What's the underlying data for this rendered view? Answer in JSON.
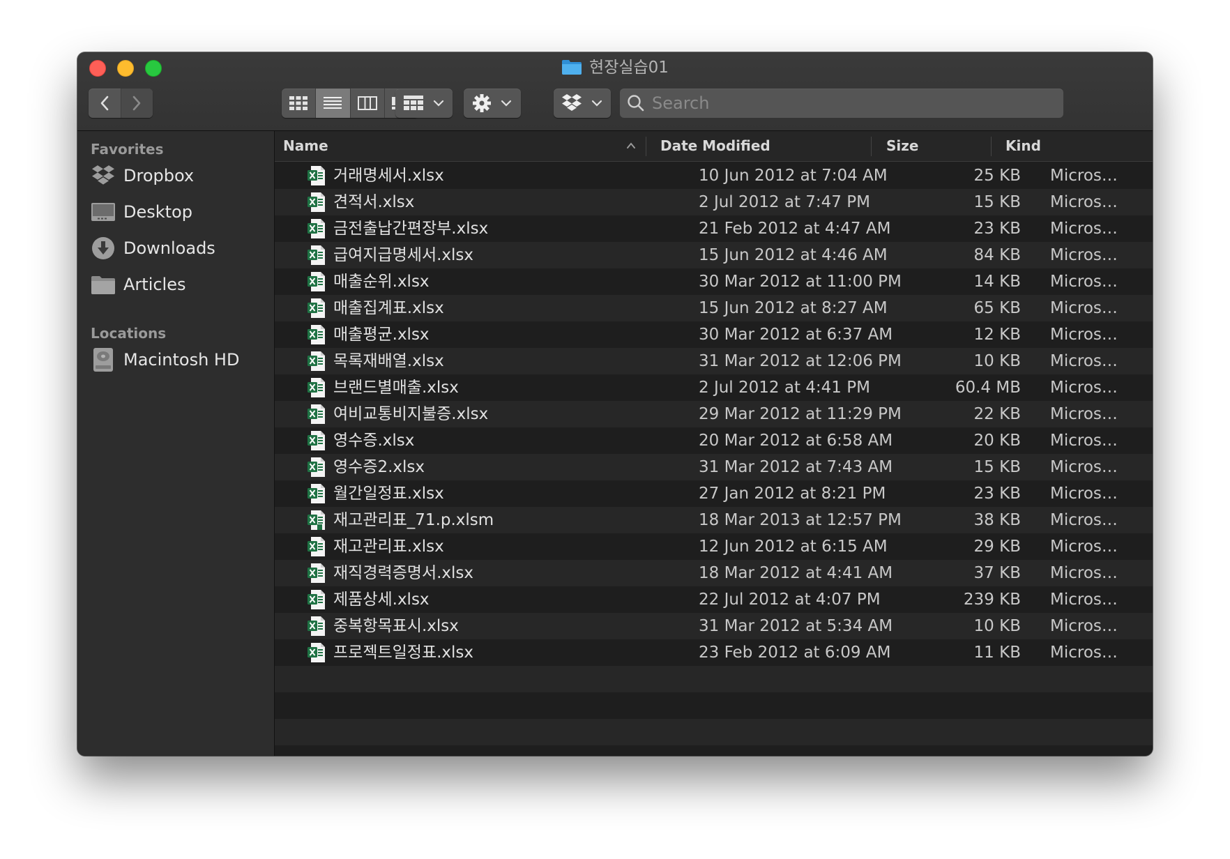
{
  "window": {
    "title": "현장실습01"
  },
  "toolbar": {
    "back_label": "Back",
    "forward_label": "Forward",
    "search_placeholder": "Search"
  },
  "sidebar": {
    "favorites_heading": "Favorites",
    "favorites": [
      {
        "label": "Dropbox",
        "icon": "dropbox-icon"
      },
      {
        "label": "Desktop",
        "icon": "desktop-icon"
      },
      {
        "label": "Downloads",
        "icon": "downloads-icon"
      },
      {
        "label": "Articles",
        "icon": "folder-icon"
      }
    ],
    "locations_heading": "Locations",
    "locations": [
      {
        "label": "Macintosh HD",
        "icon": "hard-drive-icon"
      }
    ]
  },
  "columns": {
    "name": "Name",
    "date": "Date Modified",
    "size": "Size",
    "kind": "Kind"
  },
  "files": [
    {
      "name": "거래명세서.xlsx",
      "date": "10 Jun 2012 at 7:04 AM",
      "size": "25 KB",
      "kind": "Micros…"
    },
    {
      "name": "견적서.xlsx",
      "date": "2 Jul 2012 at 7:47 PM",
      "size": "15 KB",
      "kind": "Micros…"
    },
    {
      "name": "금전출납간편장부.xlsx",
      "date": "21 Feb 2012 at 4:47 AM",
      "size": "23 KB",
      "kind": "Micros…"
    },
    {
      "name": "급여지급명세서.xlsx",
      "date": "15 Jun 2012 at 4:46 AM",
      "size": "84 KB",
      "kind": "Micros…"
    },
    {
      "name": "매출순위.xlsx",
      "date": "30 Mar 2012 at 11:00 PM",
      "size": "14 KB",
      "kind": "Micros…"
    },
    {
      "name": "매출집계표.xlsx",
      "date": "15 Jun 2012 at 8:27 AM",
      "size": "65 KB",
      "kind": "Micros…"
    },
    {
      "name": "매출평균.xlsx",
      "date": "30 Mar 2012 at 6:37 AM",
      "size": "12 KB",
      "kind": "Micros…"
    },
    {
      "name": "목록재배열.xlsx",
      "date": "31 Mar 2012 at 12:06 PM",
      "size": "10 KB",
      "kind": "Micros…"
    },
    {
      "name": "브랜드별매출.xlsx",
      "date": "2 Jul 2012 at 4:41 PM",
      "size": "60.4 MB",
      "kind": "Micros…"
    },
    {
      "name": "여비교통비지불증.xlsx",
      "date": "29 Mar 2012 at 11:29 PM",
      "size": "22 KB",
      "kind": "Micros…"
    },
    {
      "name": "영수증.xlsx",
      "date": "20 Mar 2012 at 6:58 AM",
      "size": "20 KB",
      "kind": "Micros…"
    },
    {
      "name": "영수증2.xlsx",
      "date": "31 Mar 2012 at 7:43 AM",
      "size": "15 KB",
      "kind": "Micros…"
    },
    {
      "name": "월간일정표.xlsx",
      "date": "27 Jan 2012 at 8:21 PM",
      "size": "23 KB",
      "kind": "Micros…"
    },
    {
      "name": "재고관리표_71.p.xlsm",
      "date": "18 Mar 2013 at 12:57 PM",
      "size": "38 KB",
      "kind": "Micros…",
      "macro": true
    },
    {
      "name": "재고관리표.xlsx",
      "date": "12 Jun 2012 at 6:15 AM",
      "size": "29 KB",
      "kind": "Micros…"
    },
    {
      "name": "재직경력증명서.xlsx",
      "date": "18 Mar 2012 at 4:41 AM",
      "size": "37 KB",
      "kind": "Micros…"
    },
    {
      "name": "제품상세.xlsx",
      "date": "22 Jul 2012 at 4:07 PM",
      "size": "239 KB",
      "kind": "Micros…"
    },
    {
      "name": "중복항목표시.xlsx",
      "date": "31 Mar 2012 at 5:34 AM",
      "size": "10 KB",
      "kind": "Micros…"
    },
    {
      "name": "프로젝트일정표.xlsx",
      "date": "23 Feb 2012 at 6:09 AM",
      "size": "11 KB",
      "kind": "Micros…"
    }
  ],
  "colors": {
    "accent_folder": "#3fa5e8",
    "excel_green": "#1f7244",
    "close": "#fe5f57",
    "minimize": "#febc2e",
    "zoom": "#28c840"
  }
}
